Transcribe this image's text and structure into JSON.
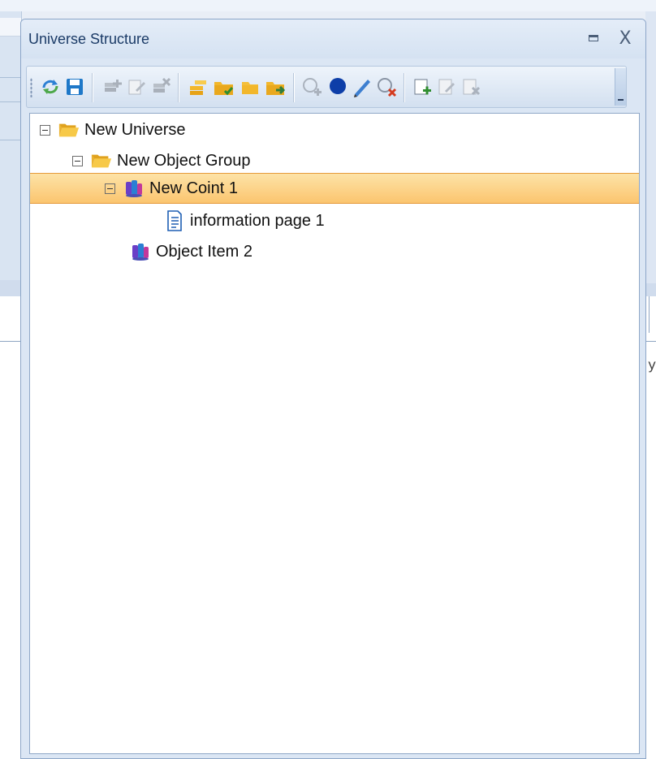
{
  "panel": {
    "title": "Universe Structure",
    "controls": {
      "restore_icon": "restore-icon",
      "close_label": "X"
    }
  },
  "toolbar": {
    "buttons": [
      {
        "name": "refresh-icon",
        "enabled": true
      },
      {
        "name": "save-icon",
        "enabled": true
      },
      {
        "name": "add-layer-icon",
        "enabled": false
      },
      {
        "name": "edit-icon",
        "enabled": false
      },
      {
        "name": "delete-layer-icon",
        "enabled": false
      },
      {
        "name": "new-layer-icon",
        "enabled": true
      },
      {
        "name": "folder-add-icon",
        "enabled": true
      },
      {
        "name": "folder-icon",
        "enabled": true
      },
      {
        "name": "folder-move-icon",
        "enabled": true
      },
      {
        "name": "add-circle-icon",
        "enabled": false
      },
      {
        "name": "blue-circle-icon",
        "enabled": true
      },
      {
        "name": "pencil-icon",
        "enabled": true
      },
      {
        "name": "remove-circle-icon",
        "enabled": true
      },
      {
        "name": "add-page-icon",
        "enabled": true
      },
      {
        "name": "edit-page-icon",
        "enabled": false
      },
      {
        "name": "delete-page-icon",
        "enabled": false
      }
    ],
    "overflow_icon": "chevron-down-icon"
  },
  "tree": {
    "nodes": [
      {
        "label": "New Universe",
        "icon": "open-folder-icon",
        "expanded": true,
        "level": 0
      },
      {
        "label": "New Object Group",
        "icon": "open-folder-icon",
        "expanded": true,
        "level": 1
      },
      {
        "label": "New Coint 1",
        "icon": "object-icon",
        "expanded": true,
        "level": 2,
        "selected": true
      },
      {
        "label": "information page 1",
        "icon": "document-icon",
        "level": 3
      },
      {
        "label": "Object Item 2",
        "icon": "object-icon",
        "level": 2
      }
    ]
  },
  "background": {
    "partial_char": "y"
  },
  "colors": {
    "selection": "#fbc56f",
    "selection_border": "#e59a3b",
    "accent": "#1e5fb4"
  }
}
